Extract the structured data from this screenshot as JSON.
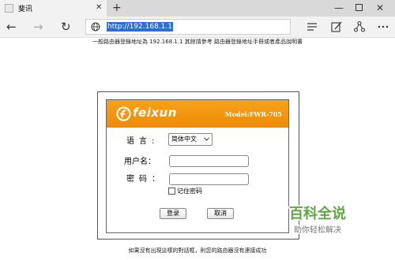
{
  "browser": {
    "tab": {
      "title": "斐讯",
      "close_glyph": "✕"
    },
    "new_tab_glyph": "+",
    "window_controls": {
      "minimize": "—",
      "close": "✕"
    },
    "nav": {
      "back": "←",
      "forward": "→",
      "refresh": "↻"
    },
    "address": {
      "url": "http://192.168.1.1"
    },
    "toolbar_icons": [
      "reading-list-icon",
      "notes-icon",
      "share-icon",
      "hub-icon"
    ]
  },
  "page": {
    "top_notice": "一般路由器登錄地址為 192.168.1.1 其餘請參考 路由器登錄地址手冊或者產品說明書",
    "bottom_notice": "如果沒有出現這樣的對話框，則您的路由器沒有連接成功",
    "login": {
      "brand": "feixun",
      "model": "Model:FWR-705",
      "language_label": "语言:",
      "language_value": "简体中文",
      "username_label": "用户名：",
      "username_value": "",
      "password_label": "密码：",
      "password_value": "",
      "remember_label": "记住密码",
      "remember_checked": false,
      "login_button": "登录",
      "cancel_button": "取消"
    }
  },
  "watermark": {
    "title": "百科全说",
    "subtitle": "助你轻松解决"
  },
  "colors": {
    "header_orange": "#f29512",
    "url_highlight": "#2b6fd6",
    "watermark_green": "#5fa844"
  }
}
